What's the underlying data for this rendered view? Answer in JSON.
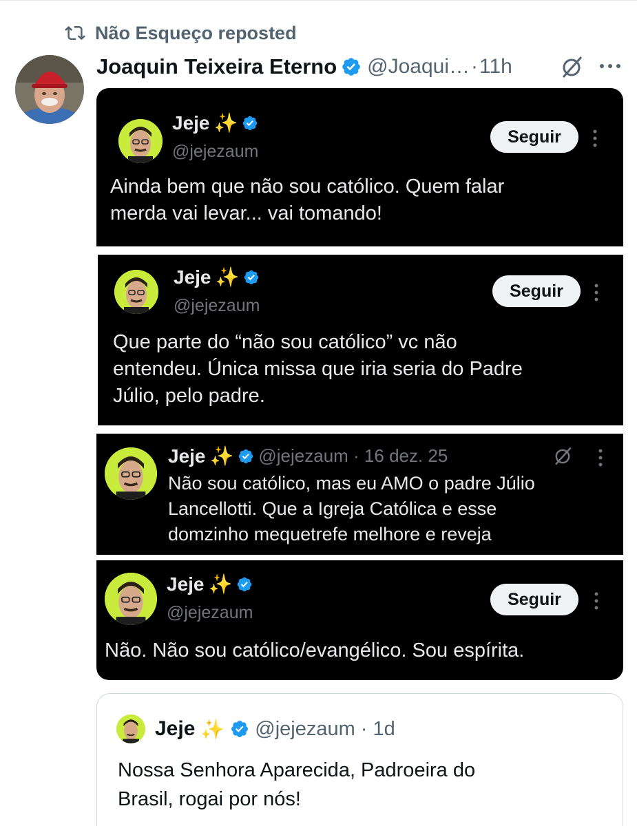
{
  "repost": {
    "icon": "repost-icon",
    "text": "Não Esqueço reposted"
  },
  "post": {
    "author_name": "Joaquin Teixeira Eterno",
    "handle": "@Joaqui…",
    "separator": "·",
    "time": "11h",
    "avatar_cap_text": "make america great again",
    "icons": [
      "verified-badge-icon",
      "grok-icon",
      "more-options-icon"
    ]
  },
  "screenshots": [
    {
      "name": "Jeje",
      "emoji": "✨",
      "handle": "@jejezaum",
      "follow_label": "Seguir",
      "text_lines": [
        "Ainda bem que não sou católico. Quem falar",
        "merda vai levar... vai tomando!"
      ]
    },
    {
      "name": "Jeje",
      "emoji": "✨",
      "handle": "@jejezaum",
      "follow_label": "Seguir",
      "text_lines": [
        "Que parte do “não sou católico” vc não",
        "entendeu. Única missa que iria seria do Padre",
        "Júlio, pelo padre."
      ]
    },
    {
      "name": "Jeje",
      "emoji": "✨",
      "handle_time": "@jejezaum · 16 dez. 25",
      "text_lines": [
        "Não sou católico, mas eu AMO o padre Júlio",
        "Lancellotti. Que a Igreja Católica e esse",
        "domzinho mequetrefe melhore e reveja"
      ]
    },
    {
      "name": "Jeje",
      "emoji": "✨",
      "handle": "@jejezaum",
      "follow_label": "Seguir",
      "text_lines": [
        "Não. Não sou católico/evangélico. Sou espírita."
      ]
    }
  ],
  "quote": {
    "name": "Jeje",
    "emoji": "✨",
    "handle": "@jejezaum",
    "separator": "·",
    "time": "1d",
    "text_lines": [
      "Nossa Senhora Aparecida, Padroeira do",
      "Brasil, rogai por nós!"
    ]
  },
  "colors": {
    "verified_blue": "#1d9bf0",
    "secondary_text": "#536471",
    "panel_bg": "#000000",
    "avatar_bg": "#c9ec3c"
  }
}
